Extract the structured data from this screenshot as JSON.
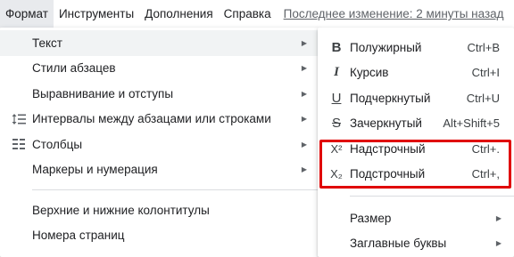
{
  "menubar": {
    "items": [
      "Формат",
      "Инструменты",
      "Дополнения",
      "Справка"
    ],
    "last_edit": "Последнее изменение: 2 минуты назад"
  },
  "format_menu": {
    "items": [
      {
        "label": "Текст",
        "icon": "none",
        "submenu": true
      },
      {
        "label": "Стили абзацев",
        "icon": "none",
        "submenu": true
      },
      {
        "label": "Выравнивание и отступы",
        "icon": "none",
        "submenu": true
      },
      {
        "label": "Интервалы между абзацами или строками",
        "icon": "line-spacing-icon",
        "submenu": true
      },
      {
        "label": "Столбцы",
        "icon": "columns-icon",
        "submenu": true
      },
      {
        "label": "Маркеры и нумерация",
        "icon": "none",
        "submenu": true
      },
      {
        "label": "Верхние и нижние колонтитулы",
        "icon": "none",
        "submenu": false
      },
      {
        "label": "Номера страниц",
        "icon": "none",
        "submenu": false
      }
    ]
  },
  "text_submenu": {
    "items": [
      {
        "label": "Полужирный",
        "shortcut": "Ctrl+B",
        "icon": "B"
      },
      {
        "label": "Курсив",
        "shortcut": "Ctrl+I",
        "icon": "I"
      },
      {
        "label": "Подчеркнутый",
        "shortcut": "Ctrl+U",
        "icon": "U"
      },
      {
        "label": "Зачеркнутый",
        "shortcut": "Alt+Shift+5",
        "icon": "S"
      },
      {
        "label": "Надстрочный",
        "shortcut": "Ctrl+.",
        "icon": "X²"
      },
      {
        "label": "Подстрочный",
        "shortcut": "Ctrl+,",
        "icon": "X₂"
      }
    ],
    "extra_items": [
      {
        "label": "Размер"
      },
      {
        "label": "Заглавные буквы"
      }
    ]
  },
  "colors": {
    "highlight_border": "#e00000",
    "hover_row": "#f1f3f4",
    "active_menu": "#e8eaed"
  }
}
